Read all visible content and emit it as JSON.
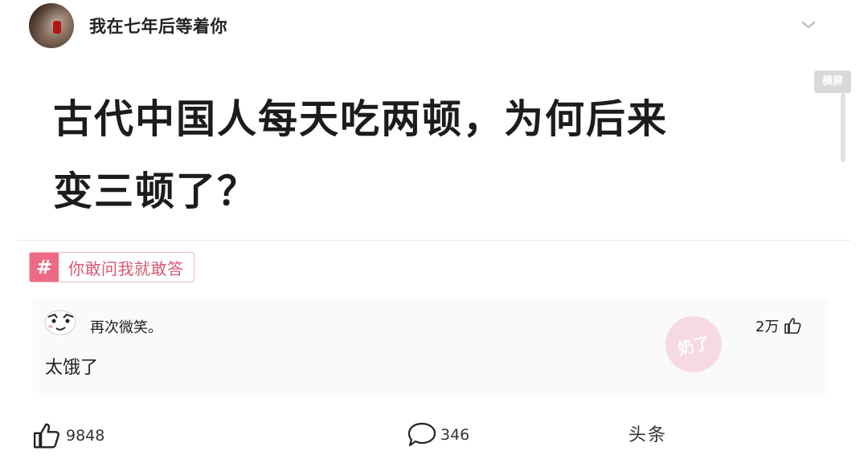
{
  "header": {
    "author_name": "我在七年后等着你"
  },
  "side_badge": "横屏",
  "question": {
    "title_line1": "古代中国人每天吃两顿，为何后来",
    "title_line2": "变三顿了？"
  },
  "topic": {
    "icon": "#",
    "label": "你敢问我就敢答"
  },
  "answer": {
    "author": "再次微笑。",
    "content": "太饿了",
    "likes": "2万"
  },
  "watermark": "奶了",
  "footer": {
    "likes": "9848",
    "comments": "346",
    "brand": "头条"
  }
}
